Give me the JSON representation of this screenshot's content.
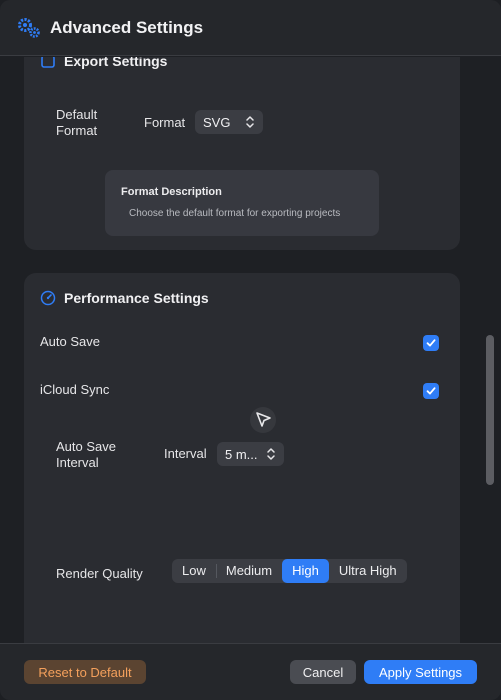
{
  "window": {
    "title": "Advanced Settings",
    "icon": "gears-icon"
  },
  "export_section": {
    "title": "Export Settings",
    "default_format_label": "Default Format",
    "format_label": "Format",
    "format_value": "SVG",
    "description_title": "Format Description",
    "description_text": "Choose the default format for exporting projects"
  },
  "performance_section": {
    "title": "Performance Settings",
    "auto_save": {
      "label": "Auto Save",
      "checked": true
    },
    "icloud_sync": {
      "label": "iCloud Sync",
      "checked": true
    },
    "auto_save_interval_label": "Auto Save Interval",
    "interval_label": "Interval",
    "interval_value": "5 m...",
    "render_quality_label": "Render Quality",
    "render_quality_options": [
      "Low",
      "Medium",
      "High",
      "Ultra High"
    ],
    "render_quality_selected": "High"
  },
  "footer": {
    "reset_label": "Reset to Default",
    "cancel_label": "Cancel",
    "apply_label": "Apply Settings"
  },
  "colors": {
    "accent": "#2f7df6",
    "reset_text": "#f4a05c",
    "reset_bg": "#5b4431",
    "card_bg": "#2a2c31",
    "window_bg": "#1e2024"
  }
}
